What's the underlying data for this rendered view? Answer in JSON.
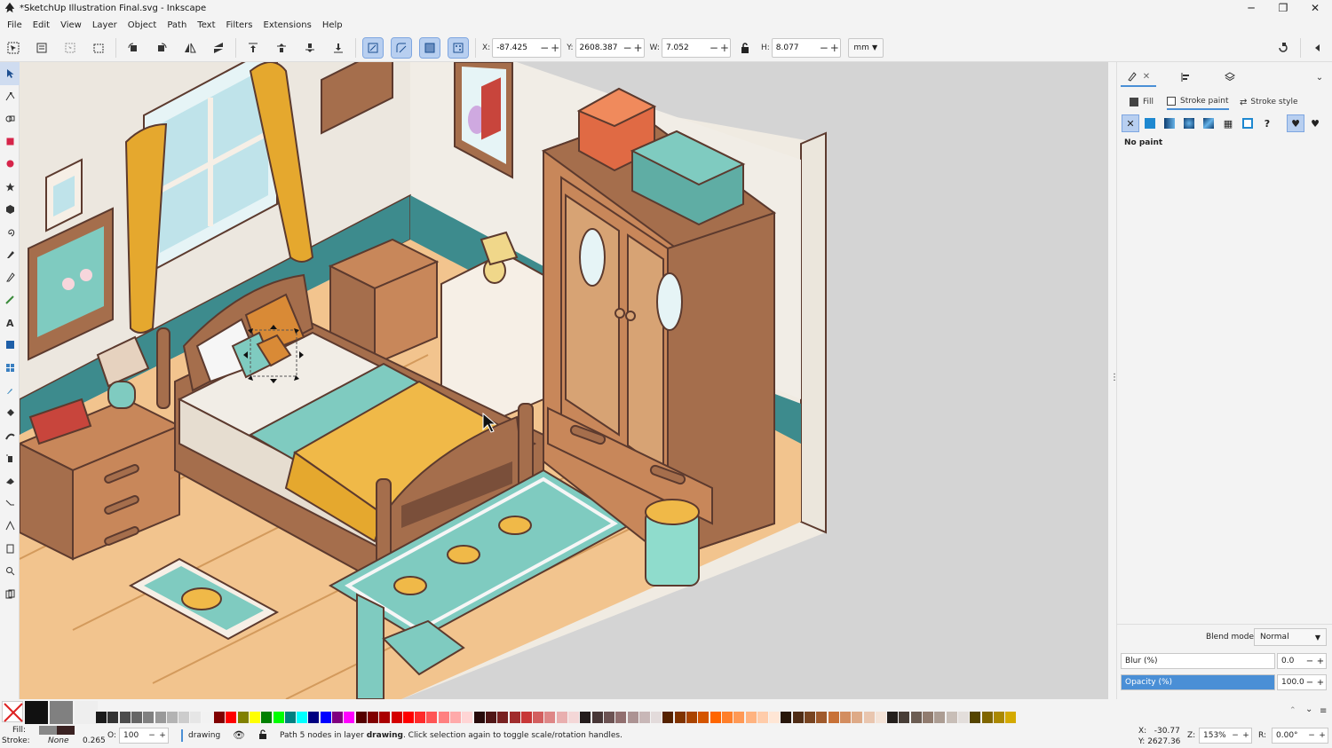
{
  "window": {
    "title": "*SketchUp Illustration Final.svg - Inkscape"
  },
  "menu": [
    "File",
    "Edit",
    "View",
    "Layer",
    "Object",
    "Path",
    "Text",
    "Filters",
    "Extensions",
    "Help"
  ],
  "toolbar": {
    "x": {
      "label": "X:",
      "value": "-87.425"
    },
    "y": {
      "label": "Y:",
      "value": "2608.387"
    },
    "w": {
      "label": "W:",
      "value": "7.052"
    },
    "h": {
      "label": "H:",
      "value": "8.077"
    },
    "unit": "mm"
  },
  "panel": {
    "tabs": [
      "fill-and-stroke",
      "align-and-distribute",
      "layers-and-objects"
    ],
    "subtabs": {
      "fill": "Fill",
      "stroke_paint": "Stroke paint",
      "stroke_style": "Stroke style"
    },
    "no_paint": "No paint",
    "blend_label": "Blend mode:",
    "blend_value": "Normal",
    "blur_label": "Blur (%)",
    "blur_value": "0.0",
    "opacity_label": "Opacity (%)",
    "opacity_value": "100.0",
    "opacity_fraction": 1.0
  },
  "status": {
    "fill_label": "Fill:",
    "stroke_label": "Stroke:",
    "stroke_value": "None",
    "stroke_width": "0.265",
    "opacity_label": "O:",
    "opacity_value": "100",
    "layer": "drawing",
    "message_pre": "Path 5 nodes in layer ",
    "message_layer": "drawing",
    "message_post": ". Click selection again to toggle scale/rotation handles.",
    "cursor_x": "X:   -30.77",
    "cursor_y": "Y: 2627.36",
    "zoom_label": "Z:",
    "zoom_value": "153%",
    "rotation_label": "R:",
    "rotation_value": "0.00°"
  },
  "colors": {
    "accent": "#4a8fd6",
    "selection": "#cfdcf0"
  },
  "palette": [
    "#ffffff",
    "#1a1a1a",
    "#333333",
    "#4d4d4d",
    "#666666",
    "#808080",
    "#999999",
    "#b3b3b3",
    "#cccccc",
    "#e6e6e6",
    "#f2f2f2",
    "#800000",
    "#ff0000",
    "#808000",
    "#ffff00",
    "#008000",
    "#00ff00",
    "#008080",
    "#00ffff",
    "#000080",
    "#0000ff",
    "#800080",
    "#ff00ff",
    "#550000",
    "#800000",
    "#aa0000",
    "#d40000",
    "#ff0000",
    "#ff2a2a",
    "#ff5555",
    "#ff8080",
    "#ffaaaa",
    "#ffd5d5",
    "#280b0b",
    "#501616",
    "#782121",
    "#a02c2c",
    "#c83737",
    "#d35f5f",
    "#de8787",
    "#e9afaf",
    "#f4d7d7",
    "#241c1c",
    "#483737",
    "#6c5353",
    "#916f6f",
    "#ac9393",
    "#c8b7b7",
    "#e3dbdb",
    "#552200",
    "#803300",
    "#aa4400",
    "#d45500",
    "#ff6600",
    "#ff7f2a",
    "#ff9955",
    "#ffb380",
    "#ffccaa",
    "#ffe6d5",
    "#28170b",
    "#502d16",
    "#784421",
    "#a05a2c",
    "#c87137",
    "#d38d5f",
    "#deaa87",
    "#e9c6af",
    "#f4e3d7",
    "#241f1c",
    "#483e37",
    "#6c5d53",
    "#917c6f",
    "#ac9d93",
    "#c8beb7",
    "#e3dedb",
    "#554400",
    "#806600",
    "#aa8800",
    "#d4aa00"
  ],
  "tools": [
    "selector",
    "node",
    "shape-builder",
    "rectangle",
    "ellipse",
    "star",
    "box3d",
    "spiral",
    "pen",
    "pencil",
    "calligraphy",
    "text",
    "gradient",
    "mesh",
    "dropper",
    "paint-bucket",
    "tweak",
    "spray",
    "eraser",
    "connector",
    "measure",
    "zoom-pages",
    "zoom",
    "pages"
  ]
}
